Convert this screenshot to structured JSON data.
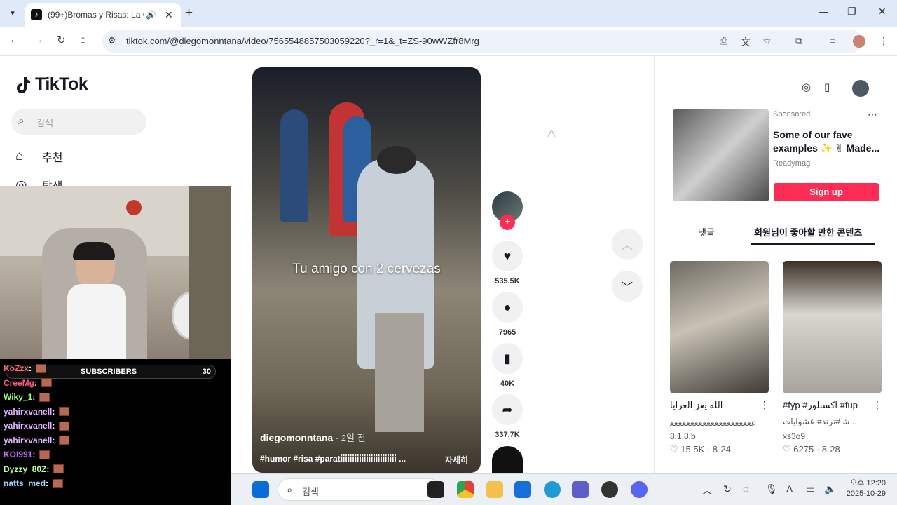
{
  "browser": {
    "tab_title": "(99+)Bromas y Risas: La Ca",
    "url": "tiktok.com/@diegomonntana/video/7565548857503059220?_r=1&_t=ZS-90wWZfr8Mrg"
  },
  "sidebar": {
    "logo_text": "TikTok",
    "search_placeholder": "검색",
    "items": [
      {
        "label": "추천",
        "icon": "home-icon"
      },
      {
        "label": "탐색",
        "icon": "compass-icon"
      }
    ]
  },
  "stream_overlay": {
    "subscribers_label": "SUBSCRIBERS",
    "subscribers_count": "30",
    "chat": [
      {
        "name": "KoZzx",
        "color": "#ff6a6a"
      },
      {
        "name": "CreeMg",
        "color": "#ff5a8a"
      },
      {
        "name": "Wiky_1",
        "color": "#9dff6a"
      },
      {
        "name": "yahirxvanell",
        "color": "#e0b3ff"
      },
      {
        "name": "yahirxvanell",
        "color": "#e0b3ff"
      },
      {
        "name": "yahirxvanell",
        "color": "#e0b3ff"
      },
      {
        "name": "KOI991",
        "color": "#c66bff"
      },
      {
        "name": "Dyzzy_80Z",
        "color": "#b9ff9d"
      },
      {
        "name": "natts_med",
        "color": "#9ad6ff"
      }
    ]
  },
  "video": {
    "caption": "Tu amigo con 2 cervezas",
    "author": "diegomonntana",
    "age": " · 2일 전",
    "hashtags": "#humor #risa #parati̇i̇i̇i̇i̇i̇i̇i̇i̇i̇i̇i̇i̇i̇i̇i̇i̇i̇i̇i̇i̇i̇i̇i̇ ...",
    "more_label": "자세히"
  },
  "actions": {
    "likes": "535.5K",
    "comments": "7965",
    "saves": "40K",
    "shares": "337.7K"
  },
  "ad": {
    "sponsored": "Sponsored",
    "title": "Some of our fave examples ✨ ✌ Made...",
    "brand": "Readymag",
    "cta": "Sign up"
  },
  "right_tabs": {
    "comments": "댓글",
    "liked": "회원님이 좋아할 만한 콘텐츠"
  },
  "cards": [
    {
      "title": "الله يعز الغرايا",
      "author": "ﻋﻌﻌﻌﻌﻌﻌﻌﻌﻌﻌﻌﻌﻌﻌﻌﻌﻌﻌﻌﻌ...",
      "handle": "8.1.8.b",
      "stats": "♡ 15.5K · 8-24"
    },
    {
      "title": "#fyp #اكسبلور #fup",
      "author": "ﺷ #ترند# عشوايات...",
      "handle": "xs3o9",
      "stats": "♡ 6275 · 8-28"
    }
  ],
  "taskbar": {
    "search_placeholder": "검색",
    "time": "오후 12:20",
    "date": "2025-10-29"
  }
}
